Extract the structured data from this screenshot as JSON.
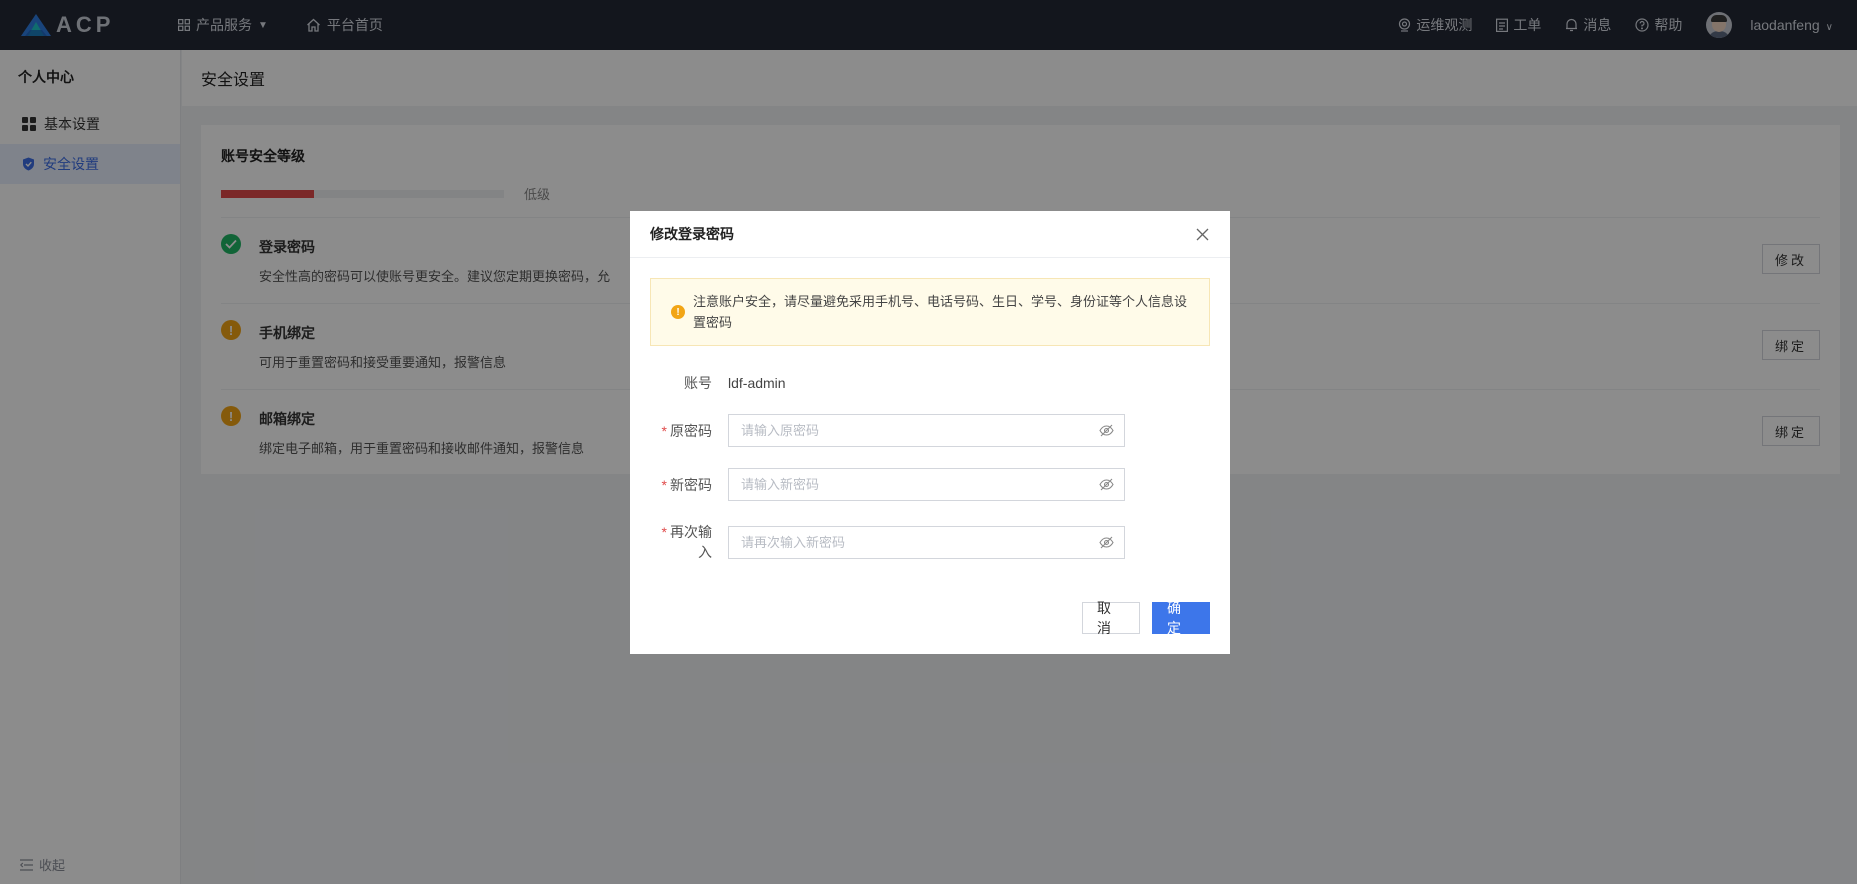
{
  "header": {
    "logo_text": "ACP",
    "nav": [
      {
        "label": "产品服务",
        "icon": "grid-icon",
        "has_dropdown": true
      },
      {
        "label": "平台首页",
        "icon": "home-icon"
      }
    ],
    "right": [
      {
        "label": "运维观测",
        "icon": "monitor-icon"
      },
      {
        "label": "工单",
        "icon": "ticket-icon"
      },
      {
        "label": "消息",
        "icon": "bell-icon"
      },
      {
        "label": "帮助",
        "icon": "help-icon"
      }
    ],
    "username": "laodanfeng"
  },
  "sidebar": {
    "title": "个人中心",
    "items": [
      {
        "label": "基本设置",
        "icon": "dashboard-icon",
        "active": false
      },
      {
        "label": "安全设置",
        "icon": "shield-icon",
        "active": true
      }
    ],
    "collapse_label": "收起"
  },
  "page": {
    "title": "安全设置"
  },
  "security": {
    "section_title": "账号安全等级",
    "level_fraction": 0.33,
    "level_label": "低级",
    "level_color": "#e04a4a",
    "items": [
      {
        "name": "登录密码",
        "desc": "安全性高的密码可以使账号更安全。建议您定期更换密码，允",
        "status": "ok",
        "button": "修改"
      },
      {
        "name": "手机绑定",
        "desc": "可用于重置密码和接受重要通知，报警信息",
        "status": "warn",
        "button": "绑定"
      },
      {
        "name": "邮箱绑定",
        "desc": "绑定电子邮箱，用于重置密码和接收邮件通知，报警信息",
        "status": "warn",
        "button": "绑定"
      }
    ]
  },
  "modal": {
    "title": "修改登录密码",
    "alert": "注意账户安全，请尽量避免采用手机号、电话号码、生日、学号、身份证等个人信息设置密码",
    "account_label": "账号",
    "account_value": "ldf-admin",
    "fields": [
      {
        "label": "原密码",
        "placeholder": "请输入原密码",
        "value": ""
      },
      {
        "label": "新密码",
        "placeholder": "请输入新密码",
        "value": ""
      },
      {
        "label": "再次输入",
        "placeholder": "请再次输入新密码",
        "value": ""
      }
    ],
    "cancel_label": "取消",
    "ok_label": "确定"
  },
  "colors": {
    "topbar": "#232936",
    "primary": "#3d76ea",
    "success": "#20b765",
    "warning": "#f2a515"
  }
}
